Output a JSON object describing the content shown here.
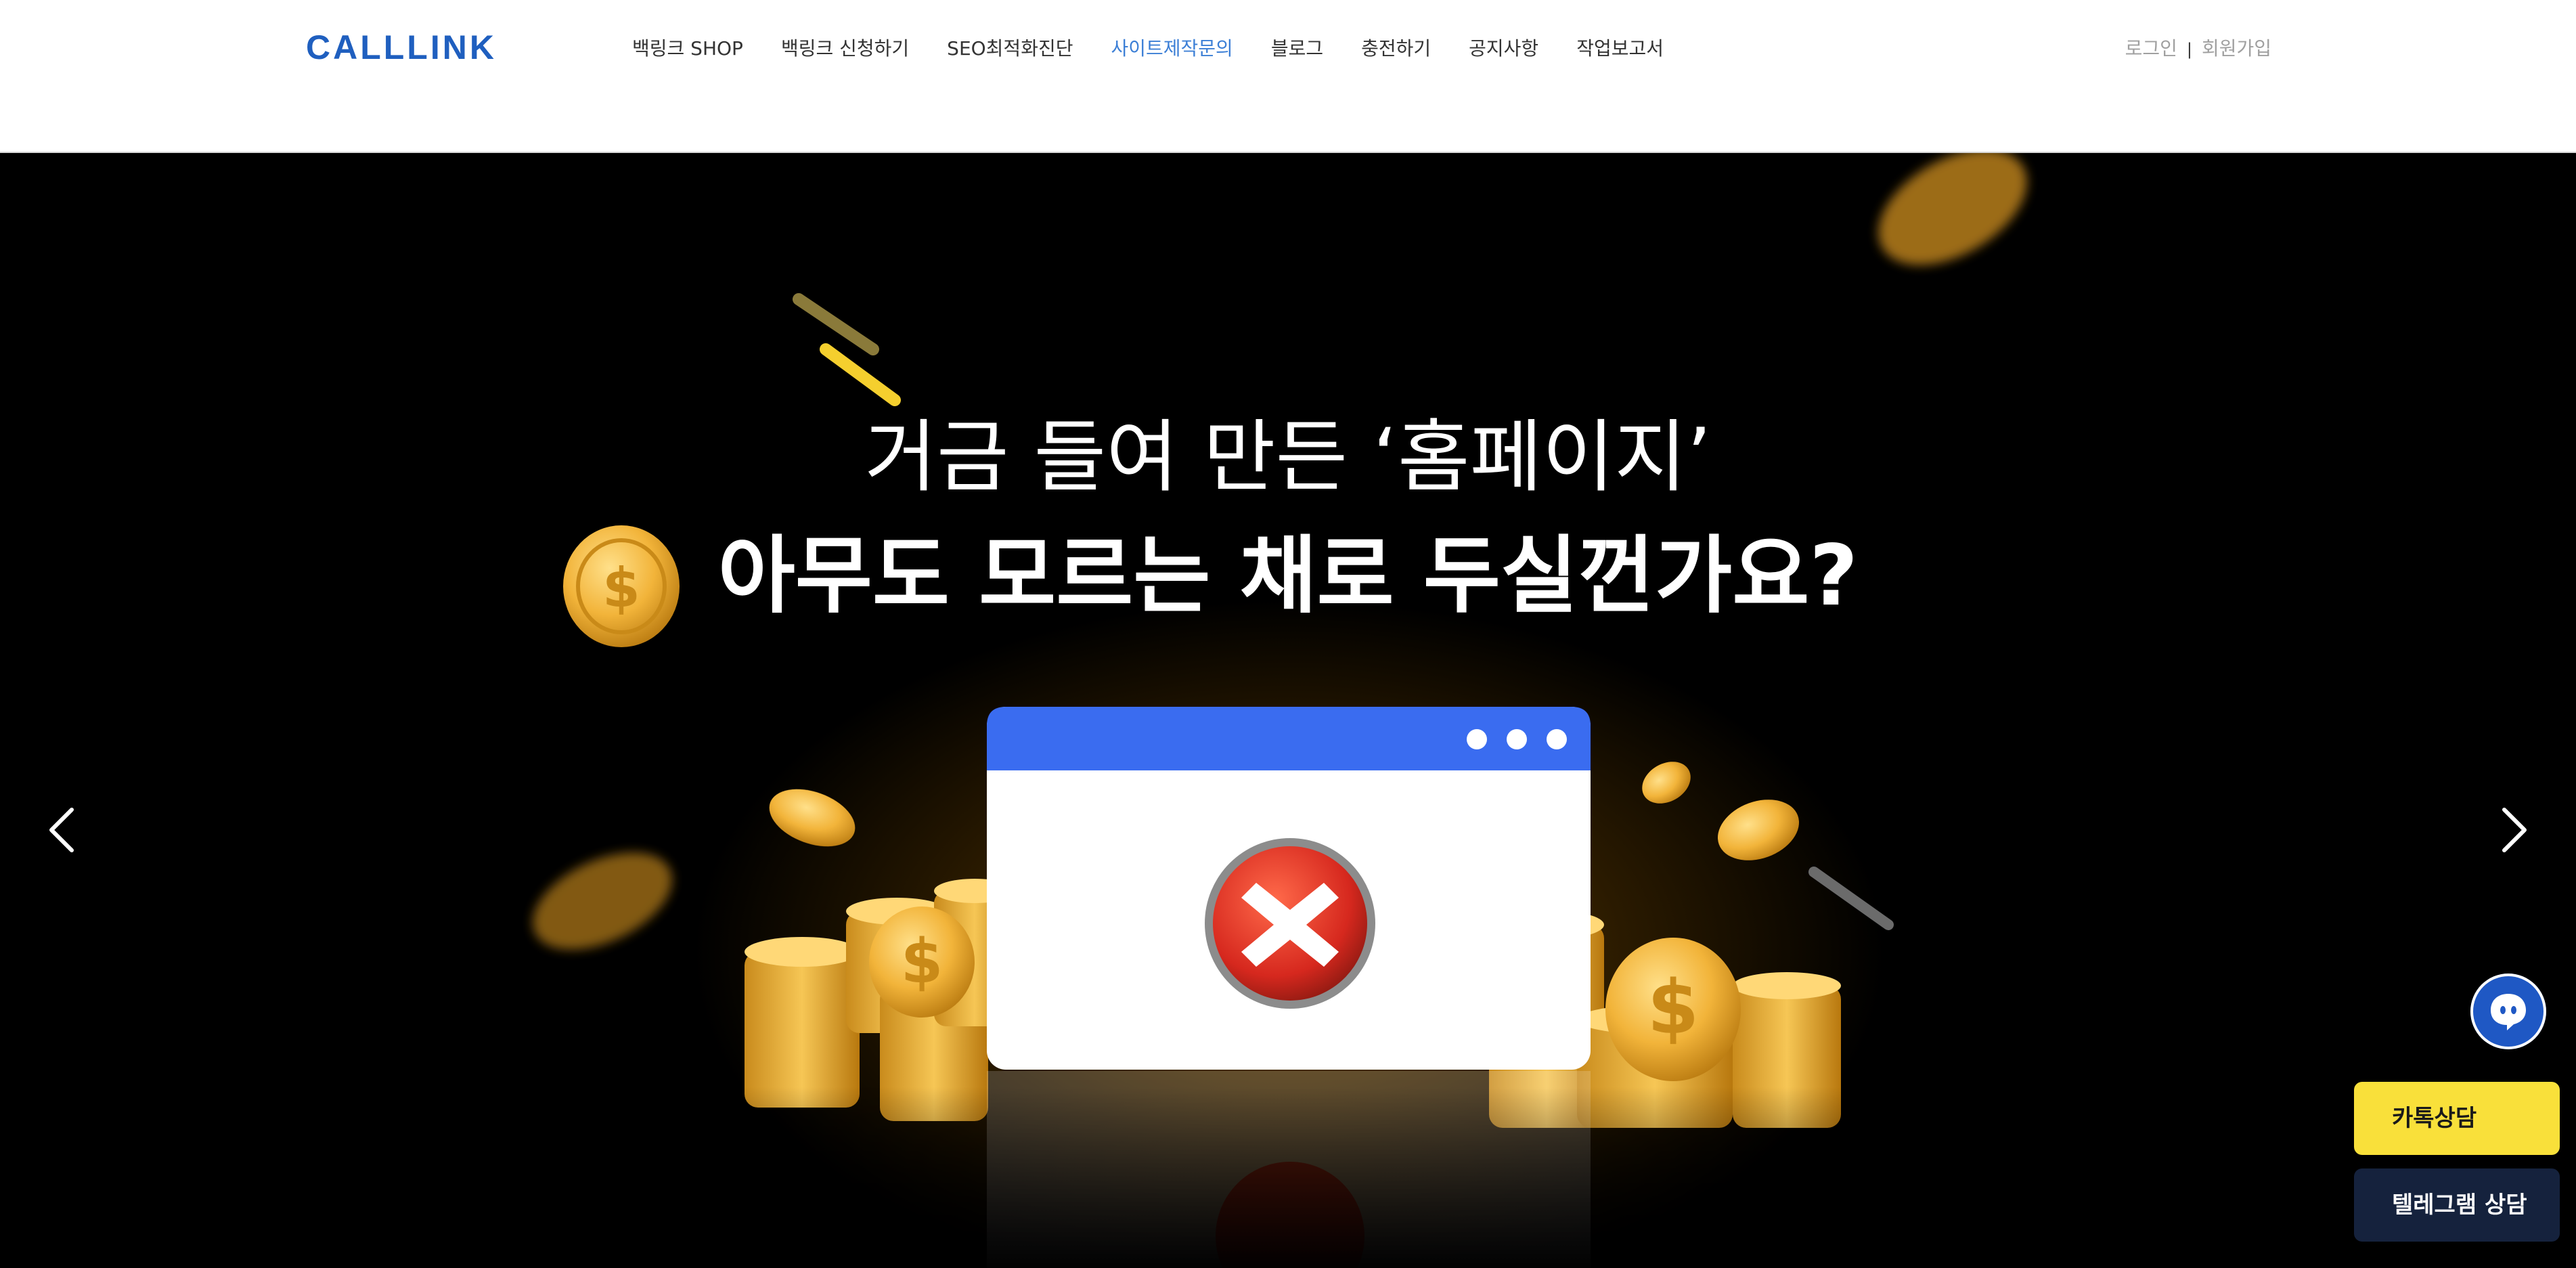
{
  "header": {
    "logo": "CALLLINK",
    "nav": [
      {
        "label": "백링크 SHOP"
      },
      {
        "label": "백링크 신청하기"
      },
      {
        "label": "SEO최적화진단"
      },
      {
        "label": "사이트제작문의",
        "active": true
      },
      {
        "label": "블로그"
      },
      {
        "label": "충전하기"
      },
      {
        "label": "공지사항"
      },
      {
        "label": "작업보고서"
      }
    ],
    "auth": {
      "login": "로그인",
      "separator": "|",
      "signup": "회원가입"
    }
  },
  "hero": {
    "headline1": "거금 들여 만든 ‘홈페이지’",
    "headline2": "아무도 모르는 채로 두실껀가요?",
    "colors": {
      "background": "#000000",
      "window_bar": "#3a6cf0",
      "coin": "#f2b43a",
      "error": "#d6281e",
      "accent_stroke": "#f5cf2e"
    }
  },
  "floating": {
    "chat_icon": "chat-bubble-icon",
    "kakao_label": "카톡상담",
    "telegram_label": "텔레그램 상담",
    "colors": {
      "kakao": "#f9e03a",
      "telegram": "#15223d",
      "chat": "#1f58c4"
    }
  }
}
